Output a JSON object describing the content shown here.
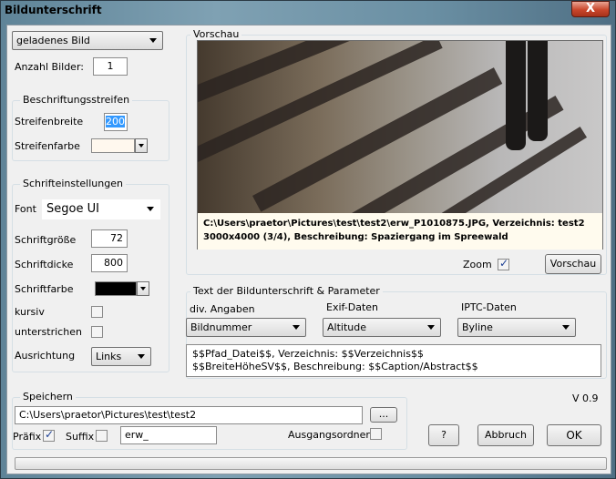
{
  "window": {
    "title": "Bildunterschrift",
    "close_label": "X"
  },
  "left": {
    "source_select": "geladenes Bild",
    "count_label": "Anzahl Bilder:",
    "count_value": "1",
    "stripe_group": "Beschriftungsstreifen",
    "stripe_width_label": "Streifenbreite",
    "stripe_width_value": "200",
    "stripe_color_label": "Streifenfarbe",
    "font_group": "Schrifteinstellungen",
    "font_label": "Font",
    "font_value": "Segoe UI",
    "size_label": "Schriftgröße",
    "size_value": "72",
    "weight_label": "Schriftdicke",
    "weight_value": "800",
    "color_label": "Schriftfarbe",
    "italic_label": "kursiv",
    "underline_label": "unterstrichen",
    "align_label": "Ausrichtung",
    "align_value": "Links"
  },
  "preview": {
    "group": "Vorschau",
    "caption_line1": "C:\\Users\\praetor\\Pictures\\test\\test2\\erw_P1010875.JPG, Verzeichnis: test2",
    "caption_line2": "3000x4000 (3/4), Beschreibung: Spaziergang im Spreewald",
    "zoom_label": "Zoom",
    "preview_button": "Vorschau"
  },
  "params": {
    "group_title": "Text der Bildunterschrift  &  Parameter",
    "col1_label": "div. Angaben",
    "col1_value": "Bildnummer",
    "col2_label": "Exif-Daten",
    "col2_value": "Altitude",
    "col3_label": "IPTC-Daten",
    "col3_value": "Byline",
    "template_text": "$$Pfad_Datei$$, Verzeichnis: $$Verzeichnis$$\n$$BreiteHöheSV$$, Beschreibung: $$Caption/Abstract$$"
  },
  "save": {
    "group": "Speichern",
    "path": "C:\\Users\\praetor\\Pictures\\test\\test2",
    "browse_label": "...",
    "prefix_label": "Präfix",
    "suffix_label": "Suffix",
    "affix_value": "erw_",
    "source_folder_label": "Ausgangsordner"
  },
  "footer": {
    "version": "V 0.9",
    "help_label": "?",
    "cancel_label": "Abbruch",
    "ok_label": "OK"
  },
  "colors": {
    "stripe_color": "#fff8ee",
    "font_color": "#000000",
    "accent": "#1c3f94"
  }
}
